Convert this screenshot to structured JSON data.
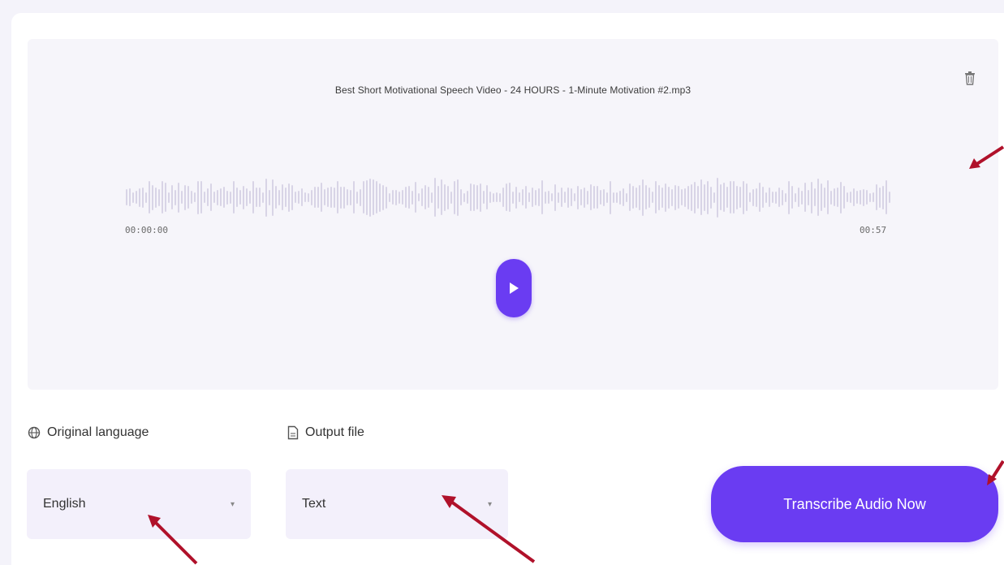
{
  "player": {
    "file_name": "Best Short Motivational Speech Video - 24 HOURS - 1-Minute Motivation #2.mp3",
    "time_current": "00:00:00",
    "time_total": "00:57",
    "icons": {
      "delete": "trash-icon",
      "play": "play-icon"
    }
  },
  "options": {
    "language": {
      "label": "Original language",
      "icon": "globe-icon",
      "value": "English"
    },
    "output": {
      "label": "Output file",
      "icon": "file-icon",
      "value": "Text"
    }
  },
  "actions": {
    "transcribe_label": "Transcribe Audio Now"
  },
  "colors": {
    "accent": "#6a3cf2",
    "panel": "#f6f5fa",
    "select_bg": "#f3f0fb",
    "annotation_arrow": "#b0112a"
  }
}
